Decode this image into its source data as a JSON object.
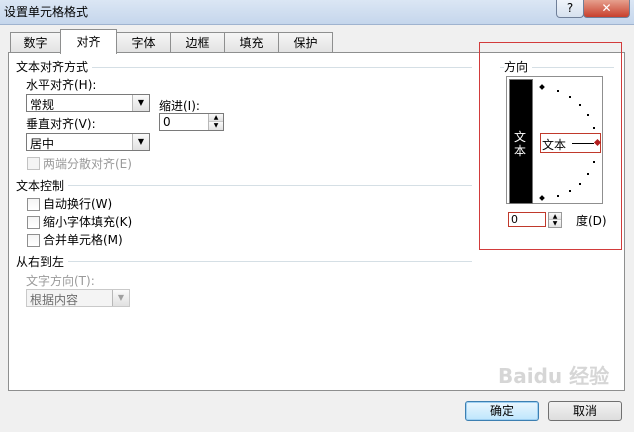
{
  "window": {
    "title": "设置单元格格式",
    "help": "?",
    "close": "✕"
  },
  "tabs": [
    {
      "label": "数字"
    },
    {
      "label": "对齐",
      "active": true
    },
    {
      "label": "字体"
    },
    {
      "label": "边框"
    },
    {
      "label": "填充"
    },
    {
      "label": "保护"
    }
  ],
  "text_alignment": {
    "title": "文本对齐方式",
    "horizontal_label": "水平对齐(H):",
    "horizontal_value": "常规",
    "indent_label": "缩进(I):",
    "indent_value": "0",
    "vertical_label": "垂直对齐(V):",
    "vertical_value": "居中",
    "justify_distributed": "两端分散对齐(E)"
  },
  "text_control": {
    "title": "文本控制",
    "wrap_text": "自动换行(W)",
    "shrink_to_fit": "缩小字体填充(K)",
    "merge_cells": "合并单元格(M)"
  },
  "rtl": {
    "title": "从右到左",
    "direction_label": "文字方向(T):",
    "direction_value": "根据内容"
  },
  "orientation": {
    "title": "方向",
    "vertical_text": "文本",
    "pointer_text": "文本",
    "degrees_value": "0",
    "degrees_label": "度(D)"
  },
  "buttons": {
    "ok": "确定",
    "cancel": "取消"
  },
  "watermark": "Baidu 经验"
}
